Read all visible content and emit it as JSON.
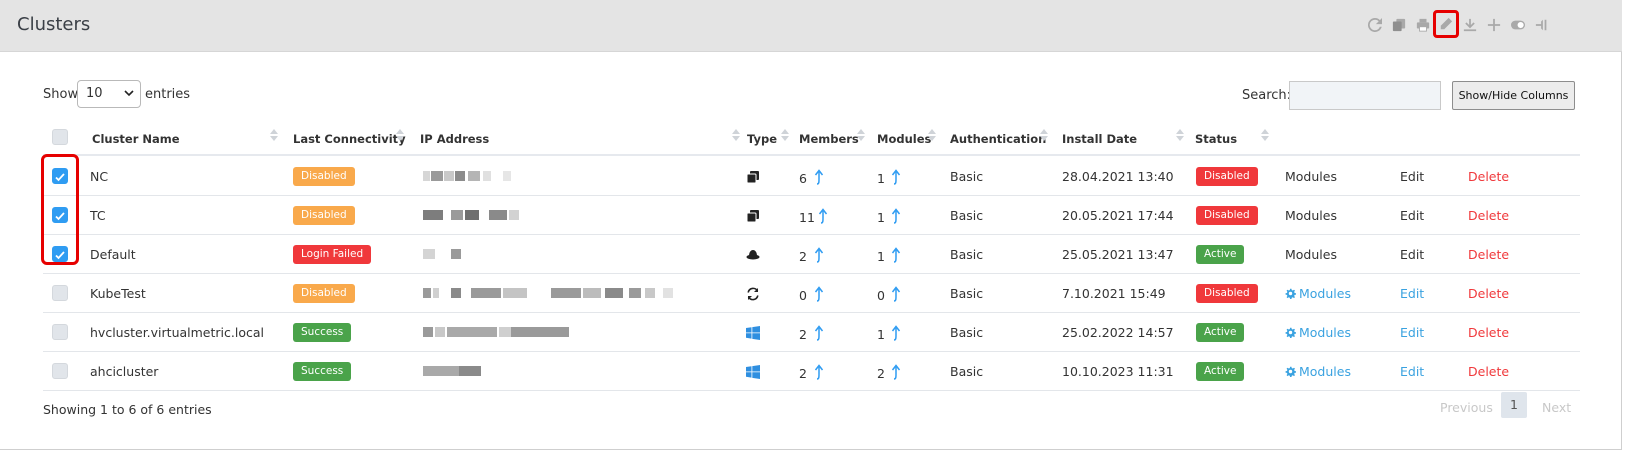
{
  "header": {
    "title": "Clusters",
    "tools": [
      "refresh-icon",
      "copy-icon",
      "print-icon",
      "edit-icon",
      "download-icon",
      "add-icon",
      "toggle-icon",
      "pin-icon"
    ]
  },
  "controls": {
    "show_label": "Show",
    "page_size": "10",
    "entries_label": "entries",
    "search_label": "Search:",
    "search_value": "",
    "show_hide_label": "Show/Hide Columns"
  },
  "columns": [
    "Cluster Name",
    "Last Connectivity",
    "IP Address",
    "Type",
    "Members",
    "Modules",
    "Authentication",
    "Install Date",
    "Status"
  ],
  "rows": [
    {
      "checked": true,
      "name": "NC",
      "connectivity": "Disabled",
      "conn_color": "orange",
      "type_icon": "copy-stack-icon",
      "members": "6",
      "modules": "1",
      "auth": "Basic",
      "install": "28.04.2021 13:40",
      "status": "Disabled",
      "status_color": "red",
      "modules_link": "Modules",
      "edit": "Edit",
      "delete": "Delete",
      "gear": false
    },
    {
      "checked": true,
      "name": "TC",
      "connectivity": "Disabled",
      "conn_color": "orange",
      "type_icon": "copy-stack-icon",
      "members": "11",
      "modules": "1",
      "auth": "Basic",
      "install": "20.05.2021 17:44",
      "status": "Disabled",
      "status_color": "red",
      "modules_link": "Modules",
      "edit": "Edit",
      "delete": "Delete",
      "gear": false
    },
    {
      "checked": true,
      "name": "Default",
      "connectivity": "Login Failed",
      "conn_color": "red",
      "type_icon": "redhat-icon",
      "members": "2",
      "modules": "1",
      "auth": "Basic",
      "install": "25.05.2021 13:47",
      "status": "Active",
      "status_color": "green",
      "modules_link": "Modules",
      "edit": "Edit",
      "delete": "Delete",
      "gear": false
    },
    {
      "checked": false,
      "name": "KubeTest",
      "connectivity": "Disabled",
      "conn_color": "orange",
      "type_icon": "sync-icon",
      "members": "0",
      "modules": "0",
      "auth": "Basic",
      "install": "7.10.2021 15:49",
      "status": "Disabled",
      "status_color": "red",
      "modules_link": "Modules",
      "edit": "Edit",
      "delete": "Delete",
      "gear": true
    },
    {
      "checked": false,
      "name": "hvcluster.virtualmetric.local",
      "connectivity": "Success",
      "conn_color": "green",
      "type_icon": "windows-icon",
      "members": "2",
      "modules": "1",
      "auth": "Basic",
      "install": "25.02.2022 14:57",
      "status": "Active",
      "status_color": "green",
      "modules_link": "Modules",
      "edit": "Edit",
      "delete": "Delete",
      "gear": true
    },
    {
      "checked": false,
      "name": "ahcicluster",
      "connectivity": "Success",
      "conn_color": "green",
      "type_icon": "windows-icon",
      "members": "2",
      "modules": "2",
      "auth": "Basic",
      "install": "10.10.2023 11:31",
      "status": "Active",
      "status_color": "green",
      "modules_link": "Modules",
      "edit": "Edit",
      "delete": "Delete",
      "gear": true
    }
  ],
  "footer": {
    "info": "Showing 1 to 6 of 6 entries",
    "previous": "Previous",
    "current_page": "1",
    "next": "Next"
  },
  "colors": {
    "orange": "#f9a94b",
    "red": "#f0383b",
    "green": "#4aa34a",
    "link": "#3aa2e0",
    "checkbox": "#2f9cf2"
  }
}
